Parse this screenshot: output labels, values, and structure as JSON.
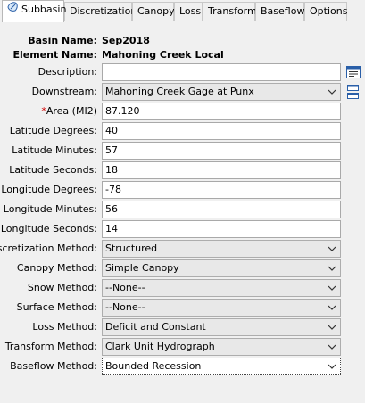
{
  "tabs": [
    {
      "label": "Subbasin",
      "active": true
    },
    {
      "label": "Discretization"
    },
    {
      "label": "Canopy"
    },
    {
      "label": "Loss"
    },
    {
      "label": "Transform"
    },
    {
      "label": "Baseflow"
    },
    {
      "label": "Options"
    }
  ],
  "header": {
    "basin_label": "Basin Name:",
    "basin_value": "Sep2018",
    "element_label": "Element Name:",
    "element_value": "Mahoning Creek Local"
  },
  "fields": {
    "description": {
      "label": "Description:",
      "value": ""
    },
    "downstream": {
      "label": "Downstream:",
      "value": "Mahoning Creek Gage at Punx"
    },
    "area": {
      "required_mark": "*",
      "label": "Area (MI2)",
      "value": "87.120"
    },
    "lat_deg": {
      "label": "Latitude Degrees:",
      "value": "40"
    },
    "lat_min": {
      "label": "Latitude Minutes:",
      "value": "57"
    },
    "lat_sec": {
      "label": "Latitude Seconds:",
      "value": "18"
    },
    "lon_deg": {
      "label": "Longitude Degrees:",
      "value": "-78"
    },
    "lon_min": {
      "label": "Longitude Minutes:",
      "value": "56"
    },
    "lon_sec": {
      "label": "Longitude Seconds:",
      "value": "14"
    },
    "discretization": {
      "label": "Discretization Method:",
      "value": "Structured"
    },
    "canopy": {
      "label": "Canopy Method:",
      "value": "Simple Canopy"
    },
    "snow": {
      "label": "Snow Method:",
      "value": "--None--"
    },
    "surface": {
      "label": "Surface Method:",
      "value": "--None--"
    },
    "loss": {
      "label": "Loss Method:",
      "value": "Deficit and Constant"
    },
    "transform": {
      "label": "Transform Method:",
      "value": "Clark Unit Hydrograph"
    },
    "baseflow": {
      "label": "Baseflow Method:",
      "value": "Bounded Recession"
    }
  },
  "icons": {
    "tab_icon": "subbasin-icon",
    "description_button": "edit-description-icon",
    "downstream_button": "select-element-icon"
  },
  "colors": {
    "required": "#d00000"
  }
}
